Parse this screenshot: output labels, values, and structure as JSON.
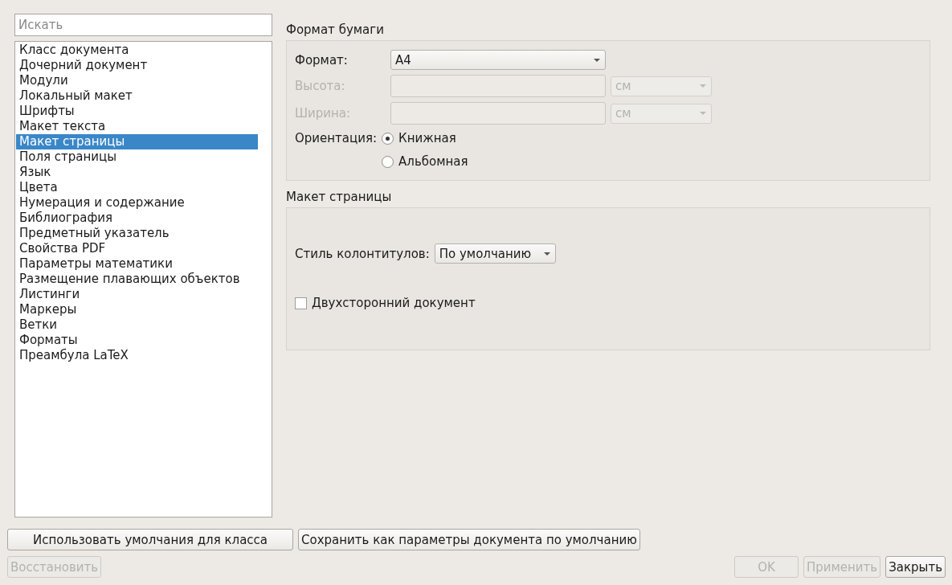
{
  "search": {
    "placeholder": "Искать"
  },
  "sidebar": {
    "items": [
      {
        "label": "Класс документа",
        "selected": false
      },
      {
        "label": "Дочерний документ",
        "selected": false
      },
      {
        "label": "Модули",
        "selected": false
      },
      {
        "label": "Локальный макет",
        "selected": false
      },
      {
        "label": "Шрифты",
        "selected": false
      },
      {
        "label": "Макет текста",
        "selected": false
      },
      {
        "label": "Макет страницы",
        "selected": true
      },
      {
        "label": "Поля страницы",
        "selected": false
      },
      {
        "label": "Язык",
        "selected": false
      },
      {
        "label": "Цвета",
        "selected": false
      },
      {
        "label": "Нумерация и содержание",
        "selected": false
      },
      {
        "label": "Библиография",
        "selected": false
      },
      {
        "label": "Предметный указатель",
        "selected": false
      },
      {
        "label": "Свойства PDF",
        "selected": false
      },
      {
        "label": "Параметры математики",
        "selected": false
      },
      {
        "label": "Размещение плавающих объектов",
        "selected": false
      },
      {
        "label": "Листинги",
        "selected": false
      },
      {
        "label": "Маркеры",
        "selected": false
      },
      {
        "label": "Ветки",
        "selected": false
      },
      {
        "label": "Форматы",
        "selected": false
      },
      {
        "label": "Преамбула LaTeX",
        "selected": false
      }
    ]
  },
  "paper_format": {
    "title": "Формат бумаги",
    "format": {
      "label": "Формат:",
      "value": "A4",
      "disabled": false
    },
    "height": {
      "label": "Высота:",
      "unit": "см",
      "disabled": true
    },
    "width": {
      "label": "Ширина:",
      "unit": "см",
      "disabled": true
    },
    "orientation": {
      "label": "Ориентация:",
      "options": [
        {
          "label": "Книжная",
          "selected": true
        },
        {
          "label": "Альбомная",
          "selected": false
        }
      ]
    }
  },
  "page_layout": {
    "title": "Макет страницы",
    "header_style": {
      "label": "Стиль колонтитулов:",
      "value": "По умолчанию"
    },
    "two_sided": {
      "label": "Двухсторонний документ",
      "checked": false
    }
  },
  "buttons_top": [
    {
      "label": "Использовать умолчания для класса",
      "disabled": false
    },
    {
      "label": "Сохранить как параметры документа по умолчанию",
      "disabled": false
    }
  ],
  "buttons_bottom_left": [
    {
      "label": "Восстановить",
      "disabled": true
    }
  ],
  "buttons_bottom_right": [
    {
      "label": "OK",
      "disabled": true
    },
    {
      "label": "Применить",
      "disabled": true
    },
    {
      "label": "Закрыть",
      "disabled": false
    }
  ]
}
